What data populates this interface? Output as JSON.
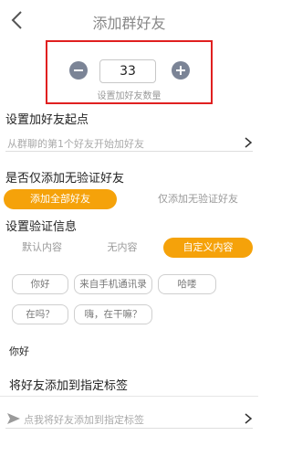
{
  "header": {
    "title": "添加群好友",
    "back_icon": "back-arrow-icon"
  },
  "counter": {
    "value": "33",
    "label": "设置加好友数量",
    "minus_icon": "minus-icon",
    "plus_icon": "plus-icon"
  },
  "start_point": {
    "title": "设置加好友起点",
    "placeholder": "从群聊的第1个好友开始加好友",
    "chevron_icon": "chevron-right-icon"
  },
  "verify_filter": {
    "title": "是否仅添加无验证好友",
    "options": [
      "添加全部好友",
      "仅添加无验证好友"
    ],
    "selected": "添加全部好友"
  },
  "verify_message": {
    "title": "设置验证信息",
    "tabs": [
      "默认内容",
      "无内容",
      "自定义内容"
    ],
    "selected_tab": "自定义内容",
    "chips": [
      "你好",
      "来自手机通讯录",
      "哈喽",
      "在吗？",
      "嗨，在干嘛？"
    ],
    "text": "你好"
  },
  "tag": {
    "title": "将好友添加到指定标签",
    "placeholder": "点我将好友添加到指定标签",
    "icon": "send-icon",
    "chevron_icon": "chevron-right-icon"
  },
  "colors": {
    "accent": "#f5a20a",
    "highlight_border": "#e02020",
    "stepper": "#7b8496"
  }
}
